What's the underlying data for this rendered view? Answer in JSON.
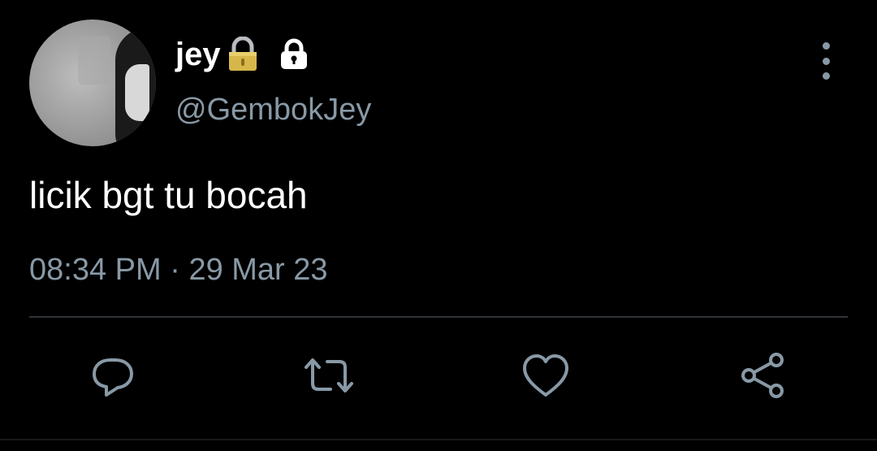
{
  "tweet": {
    "display_name": "jey",
    "handle": "@GembokJey",
    "text": "licik bgt tu bocah",
    "time": "08:34 PM",
    "separator": "·",
    "date": "29 Mar 23"
  },
  "icons": {
    "emoji": "lock-emoji-icon",
    "protected": "protected-lock-icon",
    "more": "more-vertical-icon",
    "reply": "reply-icon",
    "retweet": "retweet-icon",
    "like": "heart-icon",
    "share": "share-icon"
  },
  "colors": {
    "background": "#000000",
    "text": "#ffffff",
    "secondary": "#8899a6",
    "divider": "#2f3336",
    "lock_emoji": "#d8b74a"
  }
}
